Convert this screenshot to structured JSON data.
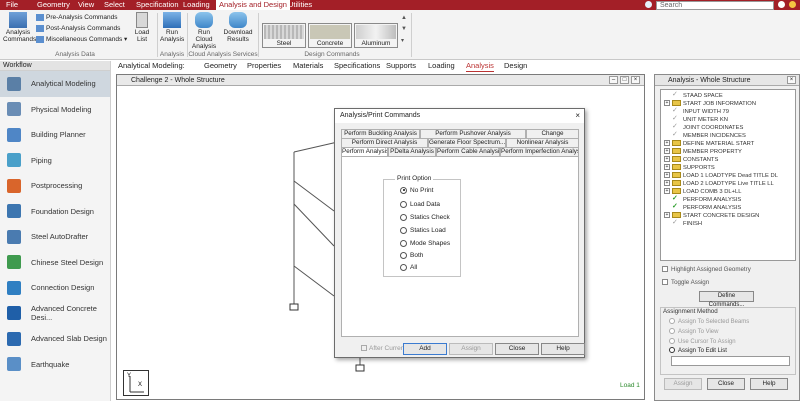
{
  "menubar": {
    "items": [
      "File",
      "Geometry",
      "View",
      "Select",
      "Specification",
      "Loading",
      "Analysis and Design",
      "Utilities"
    ],
    "active": "Analysis and Design",
    "search_placeholder": "Search"
  },
  "ribbon": {
    "analysis_commands": "Analysis Commands",
    "pre_analysis": "Pre-Analysis Commands",
    "post_analysis": "Post-Analysis Commands",
    "misc_commands": "Miscellaneous Commands",
    "load_list": "Load List",
    "analysis_data_label": "Analysis Data",
    "run_analysis": "Run Analysis",
    "analysis_group_label": "Analysis",
    "run_cloud": "Run Cloud Analysis",
    "download_results": "Download Results",
    "cloud_group_label": "Cloud Analysis Services",
    "materials": [
      "Steel",
      "Concrete",
      "Aluminum"
    ],
    "design_group_label": "Design Commands"
  },
  "workflow": {
    "header": "Workflow",
    "items": [
      {
        "label": "Analytical Modeling",
        "icon": "analytical-modeling-icon",
        "color": "#5a7fa6"
      },
      {
        "label": "Physical Modeling",
        "icon": "physical-modeling-icon",
        "color": "#6a8db5"
      },
      {
        "label": "Building Planner",
        "icon": "building-planner-icon",
        "color": "#4f86c6"
      },
      {
        "label": "Piping",
        "icon": "piping-icon",
        "color": "#4aa0c9"
      },
      {
        "label": "Postprocessing",
        "icon": "postprocessing-icon",
        "color": "#d9652b"
      },
      {
        "label": "Foundation Design",
        "icon": "foundation-design-icon",
        "color": "#3d76b0"
      },
      {
        "label": "Steel AutoDrafter",
        "icon": "steel-autodrafter-icon",
        "color": "#4a7bb0"
      },
      {
        "label": "Chinese Steel Design",
        "icon": "chinese-steel-design-icon",
        "color": "#3f9a4e"
      },
      {
        "label": "Connection Design",
        "icon": "connection-design-icon",
        "color": "#2f7fc2"
      },
      {
        "label": "Advanced Concrete Desi...",
        "icon": "advanced-concrete-design-icon",
        "color": "#1f5fa8"
      },
      {
        "label": "Advanced Slab Design",
        "icon": "advanced-slab-design-icon",
        "color": "#2c6ab0"
      },
      {
        "label": "Earthquake",
        "icon": "earthquake-icon",
        "color": "#5a8fc7"
      }
    ]
  },
  "page_tabs": {
    "prefix": "Analytical Modeling:",
    "items": [
      "Geometry",
      "Properties",
      "Materials",
      "Specifications",
      "Supports",
      "Loading",
      "Analysis",
      "Design"
    ],
    "active": "Analysis"
  },
  "structure_window": {
    "title": "Challenge 2 - Whole Structure",
    "load_label": "Load 1"
  },
  "dialog": {
    "title": "Analysis/Print Commands",
    "tabs_row1": [
      "Perform Buckling Analysis",
      "Perform Pushover Analysis",
      "Change"
    ],
    "tabs_row2": [
      "Perform Direct Analysis",
      "Generate Floor Spectrum...",
      "Nonlinear Analysis"
    ],
    "tabs_row3": [
      "Perform Analysis",
      "PDelta Analysis",
      "Perform Cable Analysis",
      "Perform Imperfection Analysis"
    ],
    "print_option_label": "Print Option",
    "options": [
      "No Print",
      "Load Data",
      "Statics Check",
      "Statics Load",
      "Mode Shapes",
      "Both",
      "All"
    ],
    "selected_option": "No Print",
    "after_current": "After Current",
    "buttons": {
      "add": "Add",
      "assign": "Assign",
      "close": "Close",
      "help": "Help"
    }
  },
  "analysis_panel": {
    "title": "Analysis - Whole Structure",
    "tree": [
      {
        "label": "STAAD SPACE",
        "icon": "check",
        "expandable": false
      },
      {
        "label": "START JOB INFORMATION",
        "icon": "folder",
        "expandable": true
      },
      {
        "label": "INPUT WIDTH 79",
        "icon": "check",
        "expandable": false
      },
      {
        "label": "UNIT METER KN",
        "icon": "check",
        "expandable": false
      },
      {
        "label": "JOINT COORDINATES",
        "icon": "check",
        "expandable": false
      },
      {
        "label": "MEMBER INCIDENCES",
        "icon": "check",
        "expandable": false
      },
      {
        "label": "DEFINE MATERIAL START",
        "icon": "folder",
        "expandable": true
      },
      {
        "label": "MEMBER PROPERTY",
        "icon": "folder",
        "expandable": true
      },
      {
        "label": "CONSTANTS",
        "icon": "folder",
        "expandable": true
      },
      {
        "label": "SUPPORTS",
        "icon": "folder",
        "expandable": true
      },
      {
        "label": "LOAD 1 LOADTYPE Dead  TITLE DL",
        "icon": "folder",
        "expandable": true
      },
      {
        "label": "LOAD 2 LOADTYPE Live  TITLE LL",
        "icon": "folder",
        "expandable": true
      },
      {
        "label": "LOAD COMB 3 DL+LL",
        "icon": "folder",
        "expandable": true
      },
      {
        "label": "PERFORM ANALYSIS",
        "icon": "gcheck",
        "expandable": false
      },
      {
        "label": "PERFORM ANALYSIS",
        "icon": "gcheck",
        "expandable": false
      },
      {
        "label": "START CONCRETE DESIGN",
        "icon": "folder",
        "expandable": true
      },
      {
        "label": "FINISH",
        "icon": "check",
        "expandable": false
      }
    ],
    "highlight_assigned": "Highlight Assigned Geometry",
    "toggle_assign": "Toggle Assign",
    "define_commands": "Define Commands...",
    "assignment_method": "Assignment Method",
    "methods": [
      "Assign To Selected Beams",
      "Assign To View",
      "Use Cursor To Assign",
      "Assign To Edit List"
    ],
    "selected_method": "Assign To Edit List",
    "buttons": {
      "assign": "Assign",
      "close": "Close",
      "help": "Help"
    }
  },
  "colors": {
    "brand": "#a31f27",
    "accent_green": "#2a9d2a"
  }
}
